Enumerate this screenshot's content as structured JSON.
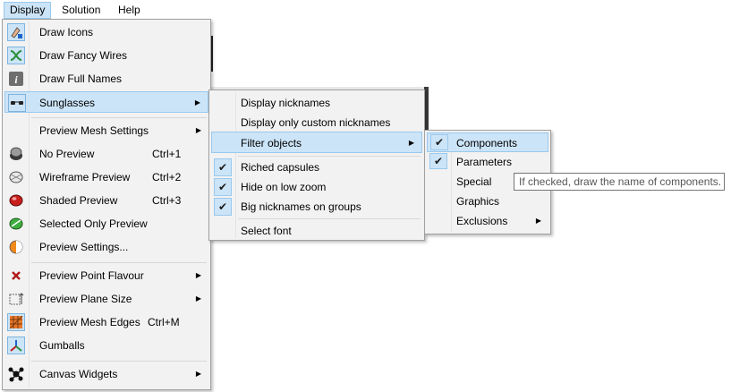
{
  "menubar": {
    "items": [
      "Display",
      "Solution",
      "Help"
    ]
  },
  "display_menu": {
    "items": [
      {
        "label": "Draw Icons",
        "icon": "draw-icons-icon"
      },
      {
        "label": "Draw Fancy Wires",
        "icon": "fancy-wires-icon"
      },
      {
        "label": "Draw Full Names",
        "icon": "info-icon"
      },
      {
        "label": "Sunglasses",
        "icon": "sunglasses-icon"
      },
      {
        "label": "Preview Mesh Settings"
      },
      {
        "label": "No Preview",
        "shortcut": "Ctrl+1",
        "icon": "no-preview-icon"
      },
      {
        "label": "Wireframe Preview",
        "shortcut": "Ctrl+2",
        "icon": "wireframe-icon"
      },
      {
        "label": "Shaded Preview",
        "shortcut": "Ctrl+3",
        "icon": "shaded-icon"
      },
      {
        "label": "Selected Only Preview",
        "icon": "selected-only-icon"
      },
      {
        "label": "Preview Settings...",
        "icon": "preview-settings-icon"
      },
      {
        "label": "Preview Point Flavour",
        "icon": "point-flavour-icon"
      },
      {
        "label": "Preview Plane Size",
        "icon": "plane-size-icon"
      },
      {
        "label": "Preview Mesh Edges",
        "shortcut": "Ctrl+M",
        "icon": "mesh-edges-icon"
      },
      {
        "label": "Gumballs",
        "icon": "gumball-icon"
      },
      {
        "label": "Canvas Widgets",
        "icon": "widgets-icon"
      }
    ]
  },
  "sunglasses_menu": {
    "items": [
      {
        "label": "Display nicknames"
      },
      {
        "label": "Display only custom nicknames"
      },
      {
        "label": "Filter objects"
      },
      {
        "label": "Riched capsules",
        "checked": true
      },
      {
        "label": "Hide on low zoom",
        "checked": true
      },
      {
        "label": "Big nicknames on groups",
        "checked": true
      },
      {
        "label": "Select font"
      }
    ]
  },
  "filter_menu": {
    "items": [
      {
        "label": "Components",
        "checked": true
      },
      {
        "label": "Parameters",
        "checked": true
      },
      {
        "label": "Special"
      },
      {
        "label": "Graphics"
      },
      {
        "label": "Exclusions"
      }
    ]
  },
  "tooltip": {
    "text": "If checked, draw the name of components."
  },
  "glyphs": {
    "check": "✔",
    "submenu_arrow": "▶"
  },
  "colors": {
    "highlight": "#cce4f7",
    "highlight_border": "#99c9ef",
    "menu_bg": "#f2f2f2"
  }
}
